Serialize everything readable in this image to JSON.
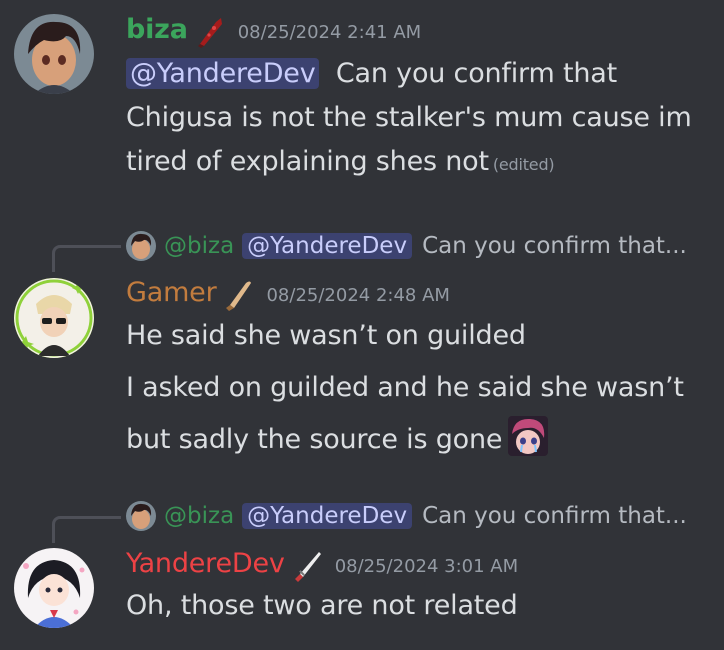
{
  "messages": [
    {
      "author": "biza",
      "author_color": "#3ba55c",
      "role_icon": "bloody-knife-icon",
      "timestamp": "08/25/2024 2:41 AM",
      "mention": "@YandereDev",
      "lines": [
        "Can you confirm that",
        "Chigusa is not the stalker's mum cause im",
        "tired of explaining shes not"
      ],
      "edited": "(edited)"
    },
    {
      "author": "Gamer",
      "author_color": "#c27c3e",
      "role_icon": "knife-icon",
      "timestamp": "08/25/2024 2:48 AM",
      "reply": {
        "author": "@biza",
        "mention": "@YandereDev",
        "preview": "Can you confirm that..."
      },
      "lines": [
        "He said she wasn’t on guilded",
        "I asked on guilded and he said she wasn’t",
        "but sadly the source is gone"
      ],
      "emoji": "crying-anime-girl-emoji"
    },
    {
      "author": "YandereDev",
      "author_color": "#ed4245",
      "role_icon": "katana-icon",
      "timestamp": "08/25/2024 3:01 AM",
      "reply": {
        "author": "@biza",
        "mention": "@YandereDev",
        "preview": "Can you confirm that..."
      },
      "lines": [
        "Oh, those two are not related"
      ]
    }
  ]
}
